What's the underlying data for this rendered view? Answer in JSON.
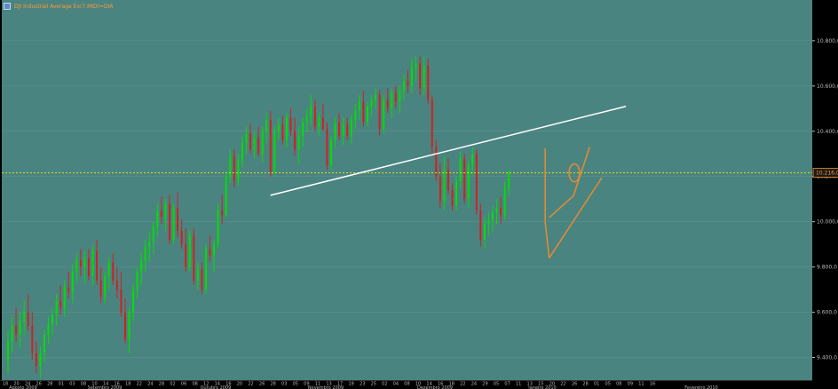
{
  "legend": {
    "text": "DJI Industrial Average Ex(7.MID)=DIA"
  },
  "colors": {
    "background": "#4a8481",
    "up": "#00e000",
    "down": "#d02020",
    "trendline": "#ffffff",
    "channel": "#e88a30",
    "hline": "#e0e020",
    "price_tag": "#ff9a30",
    "axis_bg": "#000000",
    "axis_text": "#b8b8b8"
  },
  "chart_data": {
    "type": "candlestick",
    "ylim": [
      9300,
      10980
    ],
    "y_ticks": [
      {
        "value": 9400,
        "label": "9.400,0"
      },
      {
        "value": 9600,
        "label": "9.600,0"
      },
      {
        "value": 9800,
        "label": "9.800,0"
      },
      {
        "value": 10000,
        "label": "10.000,0"
      },
      {
        "value": 10200,
        "label": "10.200,0"
      },
      {
        "value": 10400,
        "label": "10.400,0"
      },
      {
        "value": 10600,
        "label": "10.600,0"
      },
      {
        "value": 10800,
        "label": "10.800,0"
      }
    ],
    "x_day_labels": [
      "18",
      "20",
      "24",
      "26",
      "28",
      "01",
      "03",
      "08",
      "10",
      "14",
      "16",
      "18",
      "22",
      "24",
      "28",
      "02",
      "06",
      "08",
      "12",
      "14",
      "16",
      "20",
      "22",
      "26",
      "28",
      "03",
      "05",
      "09",
      "11",
      "13",
      "17",
      "19",
      "23",
      "25",
      "02",
      "04",
      "08",
      "10",
      "14",
      "16",
      "18",
      "22",
      "24",
      "29",
      "05",
      "07",
      "11",
      "13",
      "15",
      "20",
      "22",
      "26",
      "28",
      "01",
      "05",
      "08",
      "09",
      "11",
      "16"
    ],
    "x_month_labels": [
      "Agosto 2009",
      "Setembro 2009",
      "Outubro 2009",
      "Novembro 2009",
      "Dezembro 2009",
      "Janeiro 2010",
      "Fevereiro 2010"
    ],
    "last_price": {
      "value": 10216,
      "label": "10.216,0"
    },
    "candles": [
      {
        "o": 9380,
        "h": 9520,
        "l": 9330,
        "c": 9470
      },
      {
        "o": 9470,
        "h": 9580,
        "l": 9420,
        "c": 9540
      },
      {
        "o": 9540,
        "h": 9620,
        "l": 9470,
        "c": 9500
      },
      {
        "o": 9500,
        "h": 9600,
        "l": 9440,
        "c": 9560
      },
      {
        "o": 9560,
        "h": 9650,
        "l": 9500,
        "c": 9600
      },
      {
        "o": 9600,
        "h": 9680,
        "l": 9520,
        "c": 9540
      },
      {
        "o": 9540,
        "h": 9600,
        "l": 9390,
        "c": 9420
      },
      {
        "o": 9420,
        "h": 9470,
        "l": 9330,
        "c": 9360
      },
      {
        "o": 9360,
        "h": 9450,
        "l": 9310,
        "c": 9420
      },
      {
        "o": 9420,
        "h": 9520,
        "l": 9380,
        "c": 9500
      },
      {
        "o": 9500,
        "h": 9580,
        "l": 9460,
        "c": 9550
      },
      {
        "o": 9550,
        "h": 9620,
        "l": 9500,
        "c": 9590
      },
      {
        "o": 9590,
        "h": 9680,
        "l": 9540,
        "c": 9650
      },
      {
        "o": 9650,
        "h": 9720,
        "l": 9590,
        "c": 9620
      },
      {
        "o": 9620,
        "h": 9740,
        "l": 9580,
        "c": 9710
      },
      {
        "o": 9710,
        "h": 9780,
        "l": 9660,
        "c": 9690
      },
      {
        "o": 9690,
        "h": 9810,
        "l": 9640,
        "c": 9780
      },
      {
        "o": 9780,
        "h": 9860,
        "l": 9730,
        "c": 9830
      },
      {
        "o": 9830,
        "h": 9880,
        "l": 9760,
        "c": 9800
      },
      {
        "o": 9800,
        "h": 9870,
        "l": 9730,
        "c": 9840
      },
      {
        "o": 9840,
        "h": 9880,
        "l": 9740,
        "c": 9760
      },
      {
        "o": 9760,
        "h": 9900,
        "l": 9720,
        "c": 9870
      },
      {
        "o": 9870,
        "h": 9920,
        "l": 9720,
        "c": 9740
      },
      {
        "o": 9740,
        "h": 9800,
        "l": 9640,
        "c": 9670
      },
      {
        "o": 9670,
        "h": 9780,
        "l": 9640,
        "c": 9760
      },
      {
        "o": 9760,
        "h": 9840,
        "l": 9700,
        "c": 9820
      },
      {
        "o": 9820,
        "h": 9860,
        "l": 9720,
        "c": 9740
      },
      {
        "o": 9740,
        "h": 9800,
        "l": 9660,
        "c": 9700
      },
      {
        "o": 9700,
        "h": 9780,
        "l": 9580,
        "c": 9600
      },
      {
        "o": 9600,
        "h": 9660,
        "l": 9460,
        "c": 9480
      },
      {
        "o": 9480,
        "h": 9620,
        "l": 9420,
        "c": 9600
      },
      {
        "o": 9600,
        "h": 9720,
        "l": 9560,
        "c": 9700
      },
      {
        "o": 9700,
        "h": 9800,
        "l": 9660,
        "c": 9780
      },
      {
        "o": 9780,
        "h": 9860,
        "l": 9720,
        "c": 9830
      },
      {
        "o": 9830,
        "h": 9920,
        "l": 9780,
        "c": 9890
      },
      {
        "o": 9890,
        "h": 9950,
        "l": 9820,
        "c": 9910
      },
      {
        "o": 9910,
        "h": 10000,
        "l": 9860,
        "c": 9980
      },
      {
        "o": 9980,
        "h": 10080,
        "l": 9940,
        "c": 10050
      },
      {
        "o": 10050,
        "h": 10110,
        "l": 9990,
        "c": 10020
      },
      {
        "o": 10020,
        "h": 10100,
        "l": 9960,
        "c": 10080
      },
      {
        "o": 10080,
        "h": 10120,
        "l": 9900,
        "c": 9920
      },
      {
        "o": 9920,
        "h": 10080,
        "l": 9900,
        "c": 10060
      },
      {
        "o": 10060,
        "h": 10130,
        "l": 9930,
        "c": 9960
      },
      {
        "o": 9960,
        "h": 10010,
        "l": 9880,
        "c": 9900
      },
      {
        "o": 9900,
        "h": 9970,
        "l": 9780,
        "c": 9800
      },
      {
        "o": 9800,
        "h": 9960,
        "l": 9780,
        "c": 9940
      },
      {
        "o": 9940,
        "h": 9970,
        "l": 9720,
        "c": 9740
      },
      {
        "o": 9740,
        "h": 9820,
        "l": 9700,
        "c": 9790
      },
      {
        "o": 9790,
        "h": 9820,
        "l": 9680,
        "c": 9700
      },
      {
        "o": 9700,
        "h": 9900,
        "l": 9680,
        "c": 9880
      },
      {
        "o": 9880,
        "h": 9940,
        "l": 9820,
        "c": 9850
      },
      {
        "o": 9850,
        "h": 9920,
        "l": 9780,
        "c": 9900
      },
      {
        "o": 9900,
        "h": 10080,
        "l": 9880,
        "c": 10050
      },
      {
        "o": 10050,
        "h": 10120,
        "l": 9990,
        "c": 10030
      },
      {
        "o": 10030,
        "h": 10220,
        "l": 10020,
        "c": 10200
      },
      {
        "o": 10200,
        "h": 10320,
        "l": 10170,
        "c": 10290
      },
      {
        "o": 10290,
        "h": 10320,
        "l": 10150,
        "c": 10180
      },
      {
        "o": 10180,
        "h": 10300,
        "l": 10160,
        "c": 10270
      },
      {
        "o": 10270,
        "h": 10380,
        "l": 10240,
        "c": 10350
      },
      {
        "o": 10350,
        "h": 10420,
        "l": 10300,
        "c": 10390
      },
      {
        "o": 10390,
        "h": 10430,
        "l": 10300,
        "c": 10320
      },
      {
        "o": 10320,
        "h": 10400,
        "l": 10280,
        "c": 10370
      },
      {
        "o": 10370,
        "h": 10420,
        "l": 10290,
        "c": 10300
      },
      {
        "o": 10300,
        "h": 10420,
        "l": 10260,
        "c": 10400
      },
      {
        "o": 10400,
        "h": 10480,
        "l": 10350,
        "c": 10450
      },
      {
        "o": 10450,
        "h": 10490,
        "l": 10200,
        "c": 10220
      },
      {
        "o": 10220,
        "h": 10420,
        "l": 10210,
        "c": 10400
      },
      {
        "o": 10400,
        "h": 10460,
        "l": 10360,
        "c": 10430
      },
      {
        "o": 10430,
        "h": 10470,
        "l": 10340,
        "c": 10360
      },
      {
        "o": 10360,
        "h": 10480,
        "l": 10330,
        "c": 10460
      },
      {
        "o": 10460,
        "h": 10500,
        "l": 10380,
        "c": 10400
      },
      {
        "o": 10400,
        "h": 10460,
        "l": 10290,
        "c": 10320
      },
      {
        "o": 10320,
        "h": 10420,
        "l": 10260,
        "c": 10380
      },
      {
        "o": 10380,
        "h": 10460,
        "l": 10330,
        "c": 10440
      },
      {
        "o": 10440,
        "h": 10500,
        "l": 10400,
        "c": 10470
      },
      {
        "o": 10470,
        "h": 10560,
        "l": 10430,
        "c": 10510
      },
      {
        "o": 10510,
        "h": 10540,
        "l": 10400,
        "c": 10420
      },
      {
        "o": 10420,
        "h": 10480,
        "l": 10380,
        "c": 10460
      },
      {
        "o": 10460,
        "h": 10520,
        "l": 10400,
        "c": 10410
      },
      {
        "o": 10410,
        "h": 10440,
        "l": 10230,
        "c": 10250
      },
      {
        "o": 10250,
        "h": 10380,
        "l": 10230,
        "c": 10360
      },
      {
        "o": 10360,
        "h": 10460,
        "l": 10330,
        "c": 10440
      },
      {
        "o": 10440,
        "h": 10480,
        "l": 10360,
        "c": 10380
      },
      {
        "o": 10380,
        "h": 10460,
        "l": 10340,
        "c": 10430
      },
      {
        "o": 10430,
        "h": 10460,
        "l": 10360,
        "c": 10380
      },
      {
        "o": 10380,
        "h": 10470,
        "l": 10340,
        "c": 10450
      },
      {
        "o": 10450,
        "h": 10520,
        "l": 10410,
        "c": 10490
      },
      {
        "o": 10490,
        "h": 10560,
        "l": 10450,
        "c": 10530
      },
      {
        "o": 10530,
        "h": 10580,
        "l": 10420,
        "c": 10440
      },
      {
        "o": 10440,
        "h": 10530,
        "l": 10420,
        "c": 10510
      },
      {
        "o": 10510,
        "h": 10560,
        "l": 10470,
        "c": 10540
      },
      {
        "o": 10540,
        "h": 10590,
        "l": 10500,
        "c": 10560
      },
      {
        "o": 10560,
        "h": 10580,
        "l": 10380,
        "c": 10410
      },
      {
        "o": 10410,
        "h": 10560,
        "l": 10390,
        "c": 10540
      },
      {
        "o": 10540,
        "h": 10590,
        "l": 10480,
        "c": 10500
      },
      {
        "o": 10500,
        "h": 10590,
        "l": 10460,
        "c": 10570
      },
      {
        "o": 10570,
        "h": 10600,
        "l": 10500,
        "c": 10530
      },
      {
        "o": 10530,
        "h": 10600,
        "l": 10480,
        "c": 10580
      },
      {
        "o": 10580,
        "h": 10650,
        "l": 10540,
        "c": 10620
      },
      {
        "o": 10620,
        "h": 10670,
        "l": 10570,
        "c": 10600
      },
      {
        "o": 10600,
        "h": 10720,
        "l": 10570,
        "c": 10680
      },
      {
        "o": 10680,
        "h": 10730,
        "l": 10620,
        "c": 10700
      },
      {
        "o": 10700,
        "h": 10730,
        "l": 10560,
        "c": 10590
      },
      {
        "o": 10590,
        "h": 10730,
        "l": 10560,
        "c": 10690
      },
      {
        "o": 10690,
        "h": 10720,
        "l": 10520,
        "c": 10540
      },
      {
        "o": 10540,
        "h": 10560,
        "l": 10300,
        "c": 10330
      },
      {
        "o": 10330,
        "h": 10360,
        "l": 10180,
        "c": 10200
      },
      {
        "o": 10200,
        "h": 10260,
        "l": 10060,
        "c": 10090
      },
      {
        "o": 10090,
        "h": 10290,
        "l": 10050,
        "c": 10230
      },
      {
        "o": 10230,
        "h": 10280,
        "l": 10120,
        "c": 10140
      },
      {
        "o": 10140,
        "h": 10170,
        "l": 10050,
        "c": 10070
      },
      {
        "o": 10070,
        "h": 10200,
        "l": 10050,
        "c": 10180
      },
      {
        "o": 10180,
        "h": 10310,
        "l": 10150,
        "c": 10280
      },
      {
        "o": 10280,
        "h": 10300,
        "l": 10080,
        "c": 10100
      },
      {
        "o": 10100,
        "h": 10270,
        "l": 10060,
        "c": 10250
      },
      {
        "o": 10250,
        "h": 10330,
        "l": 10210,
        "c": 10300
      },
      {
        "o": 10300,
        "h": 10320,
        "l": 10030,
        "c": 10050
      },
      {
        "o": 10050,
        "h": 10080,
        "l": 9890,
        "c": 9920
      },
      {
        "o": 9920,
        "h": 10020,
        "l": 9880,
        "c": 9990
      },
      {
        "o": 9990,
        "h": 10040,
        "l": 9940,
        "c": 10010
      },
      {
        "o": 10010,
        "h": 10070,
        "l": 9960,
        "c": 10040
      },
      {
        "o": 10040,
        "h": 10100,
        "l": 9990,
        "c": 10060
      },
      {
        "o": 10060,
        "h": 10110,
        "l": 9990,
        "c": 10030
      },
      {
        "o": 10030,
        "h": 10180,
        "l": 10010,
        "c": 10150
      },
      {
        "o": 10150,
        "h": 10230,
        "l": 10120,
        "c": 10216
      }
    ],
    "annotations": {
      "trendline": {
        "from": {
          "x": 65,
          "y": 10117
        },
        "to": {
          "x": 153,
          "y": 10510
        }
      },
      "channel_upper": {
        "from": {
          "x": 133,
          "y": 10324
        },
        "to": {
          "x": 144,
          "y": 10306
        }
      },
      "channel_vertical": {
        "from": {
          "x": 133,
          "y": 9998
        },
        "to": {
          "x": 133,
          "y": 10324
        }
      },
      "channel_left": {
        "from": {
          "x": 133,
          "y": 9998
        },
        "to": {
          "x": 134,
          "y": 9840
        }
      },
      "channel_mid": {
        "from": {
          "x": 134,
          "y": 10018
        },
        "to": {
          "x": 140,
          "y": 10115
        }
      },
      "channel_lower": {
        "from": {
          "x": 134,
          "y": 9840
        },
        "to": {
          "x": 147,
          "y": 10194
        }
      },
      "circle": {
        "x": 140,
        "y": 10216
      }
    }
  }
}
